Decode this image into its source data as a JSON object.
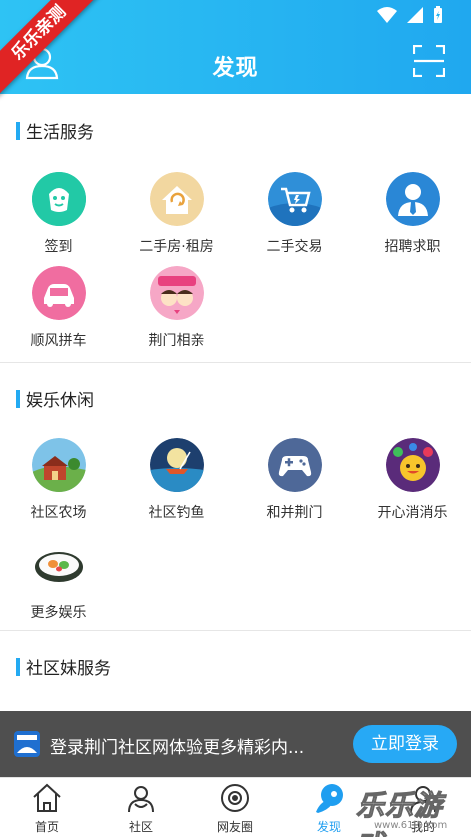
{
  "header": {
    "title": "发现",
    "ribbon": "乐乐亲测"
  },
  "sections": [
    {
      "title": "生活服务",
      "items": [
        {
          "label": "签到",
          "icon": "checkin-icon"
        },
        {
          "label": "二手房·租房",
          "icon": "house-icon"
        },
        {
          "label": "二手交易",
          "icon": "cart-icon"
        },
        {
          "label": "招聘求职",
          "icon": "recruit-icon"
        },
        {
          "label": "顺风拼车",
          "icon": "car-icon"
        },
        {
          "label": "荆门相亲",
          "icon": "dating-icon"
        }
      ]
    },
    {
      "title": "娱乐休闲",
      "items": [
        {
          "label": "社区农场",
          "icon": "farm-icon"
        },
        {
          "label": "社区钓鱼",
          "icon": "fishing-icon"
        },
        {
          "label": "和并荆门",
          "icon": "gamepad-icon"
        },
        {
          "label": "开心消消乐",
          "icon": "candy-icon"
        },
        {
          "label": "更多娱乐",
          "icon": "sushi-icon"
        }
      ]
    },
    {
      "title": "社区妹服务",
      "items": []
    }
  ],
  "banner": {
    "text": "登录荆门社区网体验更多精彩内...",
    "button": "立即登录"
  },
  "nav": [
    {
      "label": "首页",
      "icon": "home-icon"
    },
    {
      "label": "社区",
      "icon": "community-icon"
    },
    {
      "label": "网友圈",
      "icon": "circle-icon"
    },
    {
      "label": "发现",
      "icon": "discover-icon",
      "active": true
    },
    {
      "label": "我的",
      "icon": "profile-icon"
    }
  ],
  "watermark": {
    "text": "乐乐游戏",
    "url": "www.61l1.com"
  },
  "colors": {
    "accent": "#23aaf2",
    "header_start": "#2ec3f4",
    "header_end": "#20a8ef",
    "ribbon": "#e02424"
  }
}
